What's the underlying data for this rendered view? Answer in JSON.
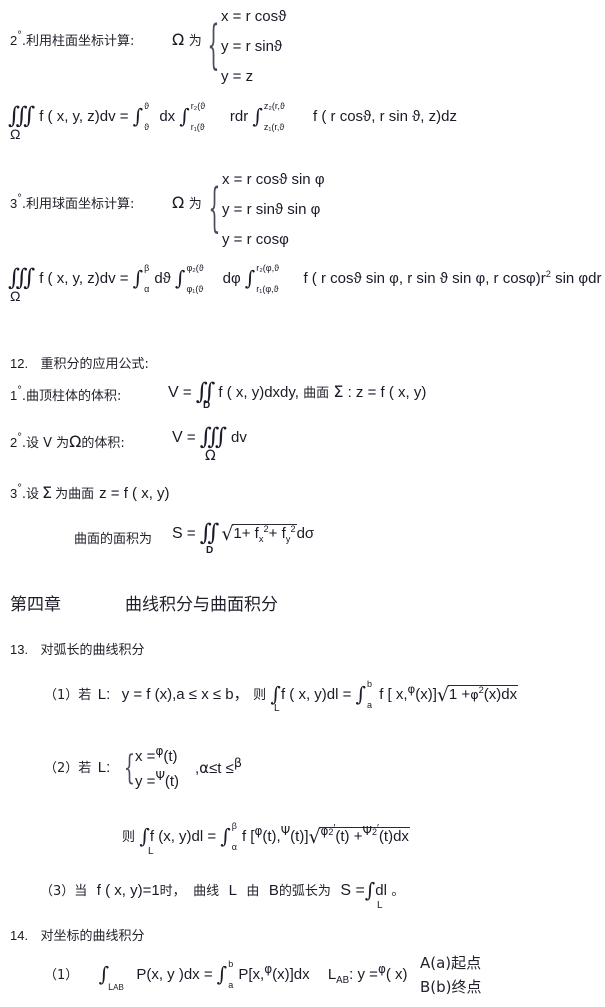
{
  "document": {
    "language": "zh-CN",
    "title_visible": false,
    "background_color": "#ffffff",
    "text_color": "#1a1a24"
  },
  "sections": {
    "cylindrical": {
      "marker": "2",
      "degree": "°",
      "label": ".利用柱面坐标计算:",
      "omega": "Ω",
      "wei": "为",
      "system": [
        "x = r cosϑ",
        "y = r sinϑ",
        "y = z"
      ],
      "formula": {
        "lhs_integral": "∭",
        "lhs_sub": "Ω",
        "lhs_body": "f ( x, y, z)dv",
        "equals": "=",
        "int1": {
          "upper": "ϑ",
          "lower": "ϑ",
          "body": "dx"
        },
        "int2": {
          "upper": "r₂(ϑ",
          "lower": "r₁(ϑ",
          "body": "rdr"
        },
        "int3": {
          "upper": "z₂(r,ϑ",
          "lower": "z₁(r,ϑ",
          "body": "f ( r cosϑ, r sin ϑ, z)dz"
        }
      }
    },
    "spherical": {
      "marker": "3",
      "degree": "°",
      "label": ".利用球面坐标计算:",
      "omega": "Ω",
      "wei": "为",
      "system": [
        "x = r cosϑ sin φ",
        "y = r sinϑ sin φ",
        "y = r cosφ"
      ],
      "formula": {
        "lhs_integral": "∭",
        "lhs_sub": "Ω",
        "lhs_body": "f ( x, y, z)dv",
        "equals": "=",
        "int1": {
          "upper": "β",
          "lower": "α",
          "body": "dϑ"
        },
        "int2": {
          "upper": "φ₂(ϑ",
          "lower": "φ₁(ϑ",
          "body": "dφ"
        },
        "int3": {
          "upper": "r₂(φ,ϑ",
          "lower": "r₁(φ,ϑ",
          "body": "f ( r cosϑ sin φ, r sin ϑ sin φ, r cosφ)r",
          "tail_exp": "2",
          "tail": " sin φdr"
        }
      }
    },
    "item12": {
      "number": "12.",
      "title": "重积分的应用公式:",
      "sub1": {
        "marker": "1",
        "degree": "°",
        "label": ".曲顶柱体的体积:",
        "V": "V",
        "equals": "=",
        "integral": "∬",
        "domain": "D",
        "body": "f ( x, y)dxdy,",
        "tail_cn": "曲面",
        "sigma": "Σ",
        "tail_math": ": z = f ( x, y)"
      },
      "sub2": {
        "marker": "2",
        "degree": "°",
        "label_a": ".设 V 为",
        "omega": "Ω",
        "label_b": "的体积:",
        "V": "V",
        "equals": "=",
        "integral": "∭",
        "domain": "Ω",
        "body": "dv"
      },
      "sub3": {
        "marker": "3",
        "degree": "°",
        "label_a": ".设",
        "sigma": "Σ",
        "label_b": "为曲面",
        "math": "z = f ( x, y)",
        "area_label": "曲面的面积为",
        "S": "S",
        "equals": "=",
        "integral": "∬",
        "domain": "D",
        "radicand_1": "1+ f",
        "sub_x": "x",
        "exp_2a": "2",
        "plus": "+ f",
        "sub_y": "y",
        "exp_2b": "2",
        "tail": "dσ"
      }
    },
    "chapter": {
      "number": "第四章",
      "title": "曲线积分与曲面积分"
    },
    "item13": {
      "number": "13.",
      "title": "对弧长的曲线积分",
      "p1": {
        "label": "（1）若",
        "L": "L:",
        "cond": "y = f (x),a ≤ x ≤ b，",
        "ze": "则",
        "int_l": "∫",
        "int_l_sub": "L",
        "body": "f ( x, y)dl",
        "equals": "=",
        "int2_upper": "b",
        "int2_lower": "a",
        "rhs": "f [ x,",
        "phi": "φ",
        "rhs2": "(x)]",
        "rad_1": "1 +",
        "rad_phi": "φ",
        "rad_exp": "2",
        "rad_tail": "(x)dx"
      },
      "p2": {
        "label": "（2）若",
        "L": "L:",
        "sys": [
          {
            "lhs": "x =",
            "fn": "φ",
            "arg": "(t)"
          },
          {
            "lhs": "y =",
            "fn": "Ψ",
            "arg": "(t)"
          }
        ],
        "cond_comma": ",",
        "alpha": "α",
        "le1": "≤t ≤",
        "beta": "β",
        "ze": "则",
        "int_l": "∫",
        "int_l_sub": "L",
        "body": "f (x, y)dl",
        "equals": "=",
        "int2_upper": "β",
        "int2_lower": "α",
        "rhs": "f [",
        "phi": "φ",
        "rhs2": "(t),",
        "psi": "Ψ",
        "rhs3": "(t)]",
        "rad_phi": "φ",
        "rad_exp_a": "2",
        "rad_prime_a": "′",
        "rad_mid": "(t) +",
        "rad_psi": "Ψ",
        "rad_exp_b": "2",
        "rad_prime_b": "′",
        "rad_tail": "(t)dx"
      },
      "p3": {
        "label": "（3）当",
        "fxy": "f ( x, y)",
        "eq1": "=1",
        "shi": "时，",
        "cn1": "曲线",
        "L": "L",
        "you": "由",
        "B": "B",
        "cn2": "的弧长为",
        "S": "S =",
        "integral": "∫",
        "int_sub": "L",
        "body": "dl",
        "period": "。"
      }
    },
    "item14": {
      "number": "14.",
      "title": "对坐标的曲线积分",
      "p1": {
        "label": "（1）",
        "int1": "∫",
        "int1_sub": "L",
        "int1_sub2": "AB",
        "body": "P(x, y )dx",
        "equals": "=",
        "int2_upper": "b",
        "int2_lower": "a",
        "rhs": "P[x,",
        "phi": "φ",
        "rhs2": "(x)]dx",
        "lab": "L",
        "lab_sub": "AB",
        "colon": ": y =",
        "phi2": "φ",
        "phi2_arg": "( x)",
        "note_a": "A(a)起点",
        "note_b": "B(b)终点"
      }
    }
  }
}
